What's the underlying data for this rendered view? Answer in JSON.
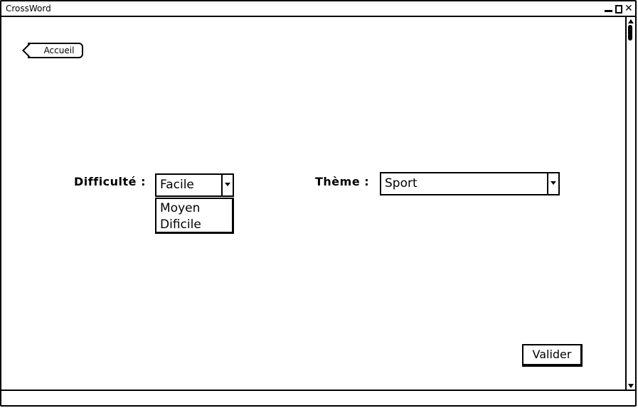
{
  "window": {
    "title": "CrossWord"
  },
  "nav": {
    "back_label": "Accueil"
  },
  "form": {
    "difficulty": {
      "label": "Difficulté :",
      "selected": "Facile",
      "options": [
        "Moyen",
        "Dificile"
      ]
    },
    "theme": {
      "label": "Thème :",
      "selected": "Sport"
    },
    "submit_label": "Valider"
  }
}
